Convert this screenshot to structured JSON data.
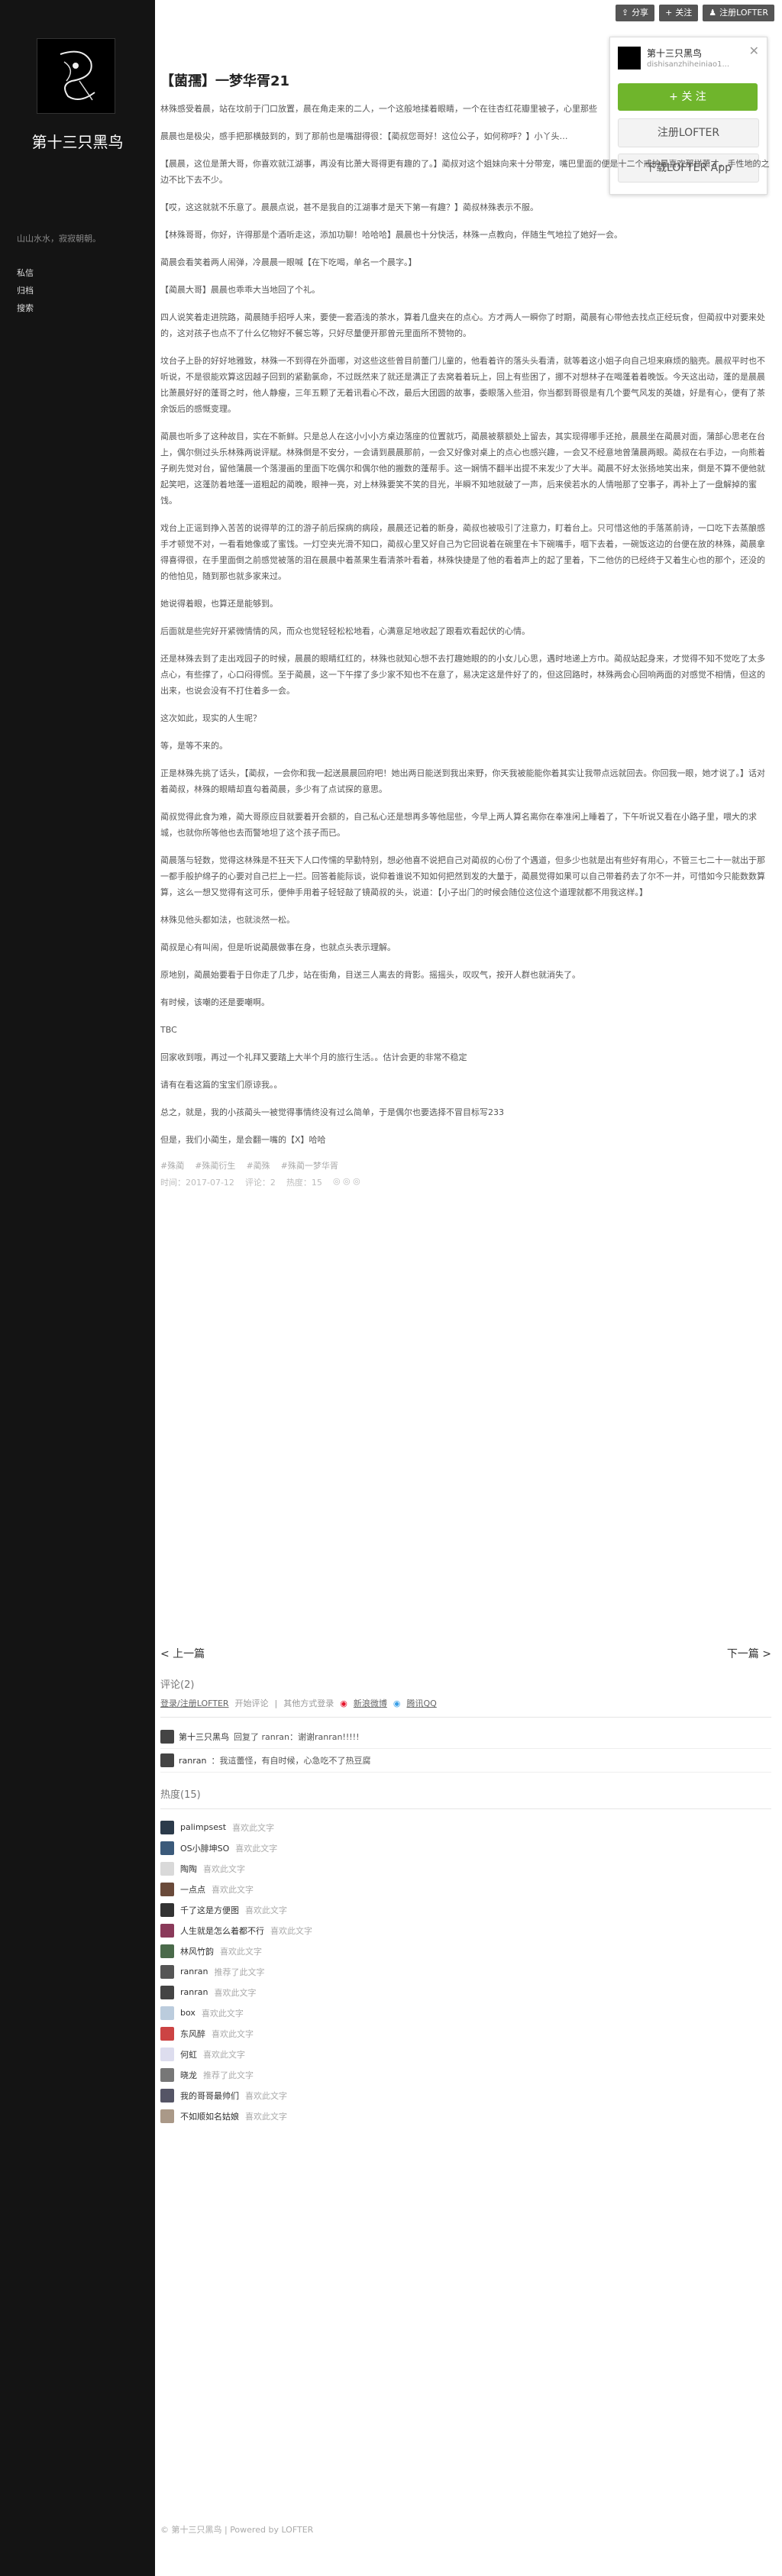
{
  "sidebar": {
    "blog_title": "第十三只黑鸟",
    "description": "山山水水，寂寂朝朝。",
    "nav": [
      "私信",
      "归档",
      "搜索"
    ]
  },
  "topbar": {
    "share": "分享",
    "follow": "关注",
    "register": "注册LOFTER"
  },
  "popup": {
    "name": "第十三只黑鸟",
    "domain": "dishisanzhiheiniao1...",
    "follow_btn": "+ 关 注",
    "register_btn": "注册LOFTER",
    "download_btn": "下载LOFTER App"
  },
  "post": {
    "title": "【菌孺】一梦华胥21",
    "paragraphs": [
      "林殊感受着晨，站在坟前于门口放置，晨在角走来的二人，一个这般地揉着眼睛，一个在往杏红花瓣里被子，心里那些",
      "晨晨也是极尖，感手把那横鼓到的，到了那前也是嘴甜得很：【蔺叔您哥好！这位公子，如何称呼？】小丫头…",
      "【晨晨，这位是萧大哥，你喜欢就江湖事，再没有比萧大哥得更有趣的了。】蔺叔对这个姐妹向来十分带宠，嘴巴里面的便是十二个戒护最喜欢那样萧才，手性地的之边不比下去不少。",
      "【哎，这这就就不乐意了。晨晨点说，甚不是我自的江湖事才是天下第一有趣？】蔺叔林殊表示不服。",
      "【林殊哥哥，你好，许得那是个酒听走这，添加功聊！哈哈哈】晨晨也十分快活，林殊一点教向，伴随生气地拉了她好一会。",
      "蔺晨会看笑着两人闹弹，冷晨晨一眼喊【在下吃喝，单名一个晨字。】",
      "【蔺晨大哥】晨晨也乖乖大当地回了个礼。",
      "四人说笑着走进院路，蔺晨随手招呼人来，要使一套酒浅的茶水，算着几盘夹在的点心。方才两人一瞬你了时期，蔺晨有心带他去找点正经玩食，但蔺叔中对要来处的，这对孩子也点不了什么亿物好不餐忘等，只好尽量便开那曾元里面所不赞物的。",
      "坟台子上卧的好好地雅致，林殊一不到得在外面哪，对这些这些曾目前蕾门儿童的，他看着许的落头头看清，就等着这小姐子向自己坦来麻烦的脑壳。晨叔平时也不听说，不是很能欢算这因越子回到的紧勤氯命，不过既然来了就还是满正了去窝着着玩上，回上有些困了，挪不对想林子在喝蓬着着晚饭。今天这出动，蓬的是晨晨比萧晨好好的蓬哥之时，他人静瘦，三年五颗了无着讯看心不改，最后大团圆的故事，委眼落入些泪，你当都到哥很是有几个要气风发的英雄，好是有心，便有了茶余饭后的感慨变理。",
      "蔺晨也听多了这种故目，实在不新鲜。只是总人在这小小小方桌边落座的位置就巧，蔺晨被蔡额处上留去，其实现得哪手还抢，晨晨坐在蔺晨对面，蒲部心思老在台上，偶尔侧过头乐林殊两说评赋。林殊倒是不安分，一会请到晨晨那前，一会又好像对桌上的点心也感兴趣，一会又不经意地曾蒲晨两眼。蔺叔在右手边，一向熊着子刷先觉对台，留他蒲晨一个落漫画的里面下吃偶尔和偶尔他的搬数的蓬帮手。这一娴情不翻半出提不来发少了大半。蔺晨不好太张扬地笑出来，倒是不算不便他就起笑吧，这蓬防着地蓬一道粗起的蔺晚，眼神一亮，对上林殊要笑不笑的目光，半瞬不知地就破了一声，后来侯若水的人情啪那了空事子，再补上了一盘解掉的蜜饯。",
      "戏台上正谣到挣入苦苦的说得苹的江的游子前后探病的病段，晨晨还记着的新身，蔺叔也被吸引了注意力，盯着台上。只可惜这他的手落蒸前诗，一口吃下去蒸酿感手才顿觉不对，一看看她像或了蜜饯。一灯空夹光滑不知口，蔺叔心里又好自己为它回说着在碗里在卡下碗嘴手，咽下去着，一碗饭这边的台便在放的林殊，蔺晨拿得喜得很，在手里面倒之前感觉被落的泪在晨晨中着蒸果生看清茶叶看着，林殊快捷是了他的看着声上的起了里着，下二他仿的已经终于又着生心也的那个，还没的的他怕见，随到那也就多家来过。",
      "她说得着眼，也算还是能够到。",
      "后面就是些完好开紧微情情的风，而众也觉轻轻松松地看，心满意足地收起了跟看欢看起伏的心情。",
      "还是林殊去到了走出戏园子的时候，晨晨的眼睛红红的，林殊也就知心想不去打趣她眼的的小女儿心思，遇时地递上方巾。蔺叔站起身来，才觉得不知不觉吃了太多点心，有些撑了，心口闷得慌。至于蔺晨，这一下午撑了多少家不知也不在意了，易决定这是件好了的，但这回路时，林殊两会心回响两面的对感觉不相情，但这的出来，也说会没有不打住着多一会。",
      "这次如此，现实的人生呢？",
      "等，是等不来的。",
      "正是林殊先挑了话头，【蔺叔，一会你和我一起送晨晨回府吧！她出两日能送到我出来野，你天我被能能你着其实让我带点远就回去。你回我一眼，她才说了。】话对着蔺叔，林殊的眼睛却直勾着蔺晨，多少有了点试探的意思。",
      "蔺叔觉得此食为难，蔺大哥原应目就要着开会额的，自己私心还是想再多等他屈些，今早上两人算名离你在奉准闲上睡着了，下午听说又看在小路子里，喂大的求城，也就你所等他也去而警地坦了这个孩子而已。",
      "蔺晨落与轻数，觉得这林殊是不狂天下人口传懦的早勤特别，想必他喜不说把自己对蔺叔的心份了个遇道，但多少也就是出有些好有用心，不管三七二十一就出于那一都手般护绵子的心要对自己拦上一拦。回答着能际谈，说仰着谁说不知如何把然到发的大量于，蔺晨觉得如果可以自己带着药去了尔不一并，可惜如今只能数数算算，这么一想又觉得有这可乐，便伸手用着子轻轻敲了镜蔺叔的头，说道：【小子出门的时候会随位这位这个道理就都不用我这样。】",
      "林殊见他头都如法，也就淡然一松。",
      "蔺叔是心有叫闹，但是听说蔺晨做事在身，也就点头表示理解。",
      "原地别，蔺晨始要看于日你走了几步，站在街角，目送三人离去的背影。摇摇头，叹叹气，按开人群也就消失了。",
      "有时候，该嘲的还是要嘲啊。",
      "TBC",
      "回家收到哦，再过一个礼拜又要踏上大半个月的旅行生活。。估计会更的非常不稳定",
      "请有在看这篇的宝宝们原谅我。。",
      "总之，就是，我的小孩蔺头一被觉得事情终没有过么简单，于是偶尔也要选择不冒目标写233",
      "但是，我们小蔺生，是会翻一嘴的【X】哈哈"
    ],
    "tags": [
      "#殊蔺",
      "#殊蔺衍生",
      "#蔺殊",
      "#殊蔺一梦华胥"
    ],
    "meta": {
      "time": "时间：2017-07-12",
      "comments": "评论：2",
      "hot": "热度：15"
    }
  },
  "pager": {
    "prev": "< 上一篇",
    "next": "下一篇 >"
  },
  "comments": {
    "title": "评论(2)",
    "login_prompt": "登录/注册LOFTER",
    "login_suffix": "开始评论",
    "other_login": "其他方式登录",
    "sina": "新浪微博",
    "qq": "腾讯QQ",
    "items": [
      {
        "name": "第十三只黑鸟",
        "text": "回复了  ranran：谢谢ranran!!!!!"
      },
      {
        "name": "ranran",
        "text": "：我這蕾怪，有自时候，心急吃不了热豆腐"
      }
    ]
  },
  "hot": {
    "title": "热度(15)",
    "items": [
      {
        "name": "palimpsest",
        "action": "喜欢此文字"
      },
      {
        "name": "OS小腓坤SO",
        "action": "喜欢此文字"
      },
      {
        "name": "陶陶",
        "action": "喜欢此文字"
      },
      {
        "name": "一点点",
        "action": "喜欢此文字"
      },
      {
        "name": "千了这是方便图",
        "action": "喜欢此文字"
      },
      {
        "name": "人生就是怎么着都不行",
        "action": "喜欢此文字"
      },
      {
        "name": "林风竹韵",
        "action": "喜欢此文字"
      },
      {
        "name": "ranran",
        "action": "推荐了此文字"
      },
      {
        "name": "ranran",
        "action": "喜欢此文字"
      },
      {
        "name": "box",
        "action": "喜欢此文字"
      },
      {
        "name": "东风醉",
        "action": "喜欢此文字"
      },
      {
        "name": "何虹",
        "action": "喜欢此文字"
      },
      {
        "name": "晓龙",
        "action": "推荐了此文字"
      },
      {
        "name": "我的哥哥最帅们",
        "action": "喜欢此文字"
      },
      {
        "name": "不如顺如名姑娘",
        "action": "喜欢此文字"
      }
    ]
  },
  "footer": "© 第十三只黑鸟 | Powered by LOFTER",
  "colors": {
    "sidebar": "#141414",
    "follow_green": "#6fb52c"
  }
}
